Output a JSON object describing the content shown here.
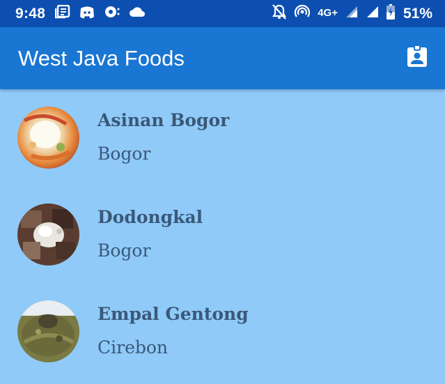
{
  "status_bar": {
    "time": "9:48",
    "network": "4G+",
    "battery": "51%",
    "left_icons": [
      "news-icon",
      "discord-icon",
      "podcast-icon",
      "cloud-icon"
    ],
    "right_icons": [
      "notifications-off-icon",
      "hotspot-icon",
      "signal-icon",
      "signal-icon",
      "battery-icon"
    ]
  },
  "app_bar": {
    "title": "West Java Foods",
    "action_icon": "profile-badge-icon"
  },
  "colors": {
    "status_bar": "#0d4fb0",
    "app_bar": "#1976d2",
    "background": "#90caf9",
    "text": "#3a5878"
  },
  "foods": [
    {
      "name": "Asinan Bogor",
      "city": "Bogor"
    },
    {
      "name": "Dodongkal",
      "city": "Bogor"
    },
    {
      "name": "Empal Gentong",
      "city": "Cirebon"
    }
  ]
}
